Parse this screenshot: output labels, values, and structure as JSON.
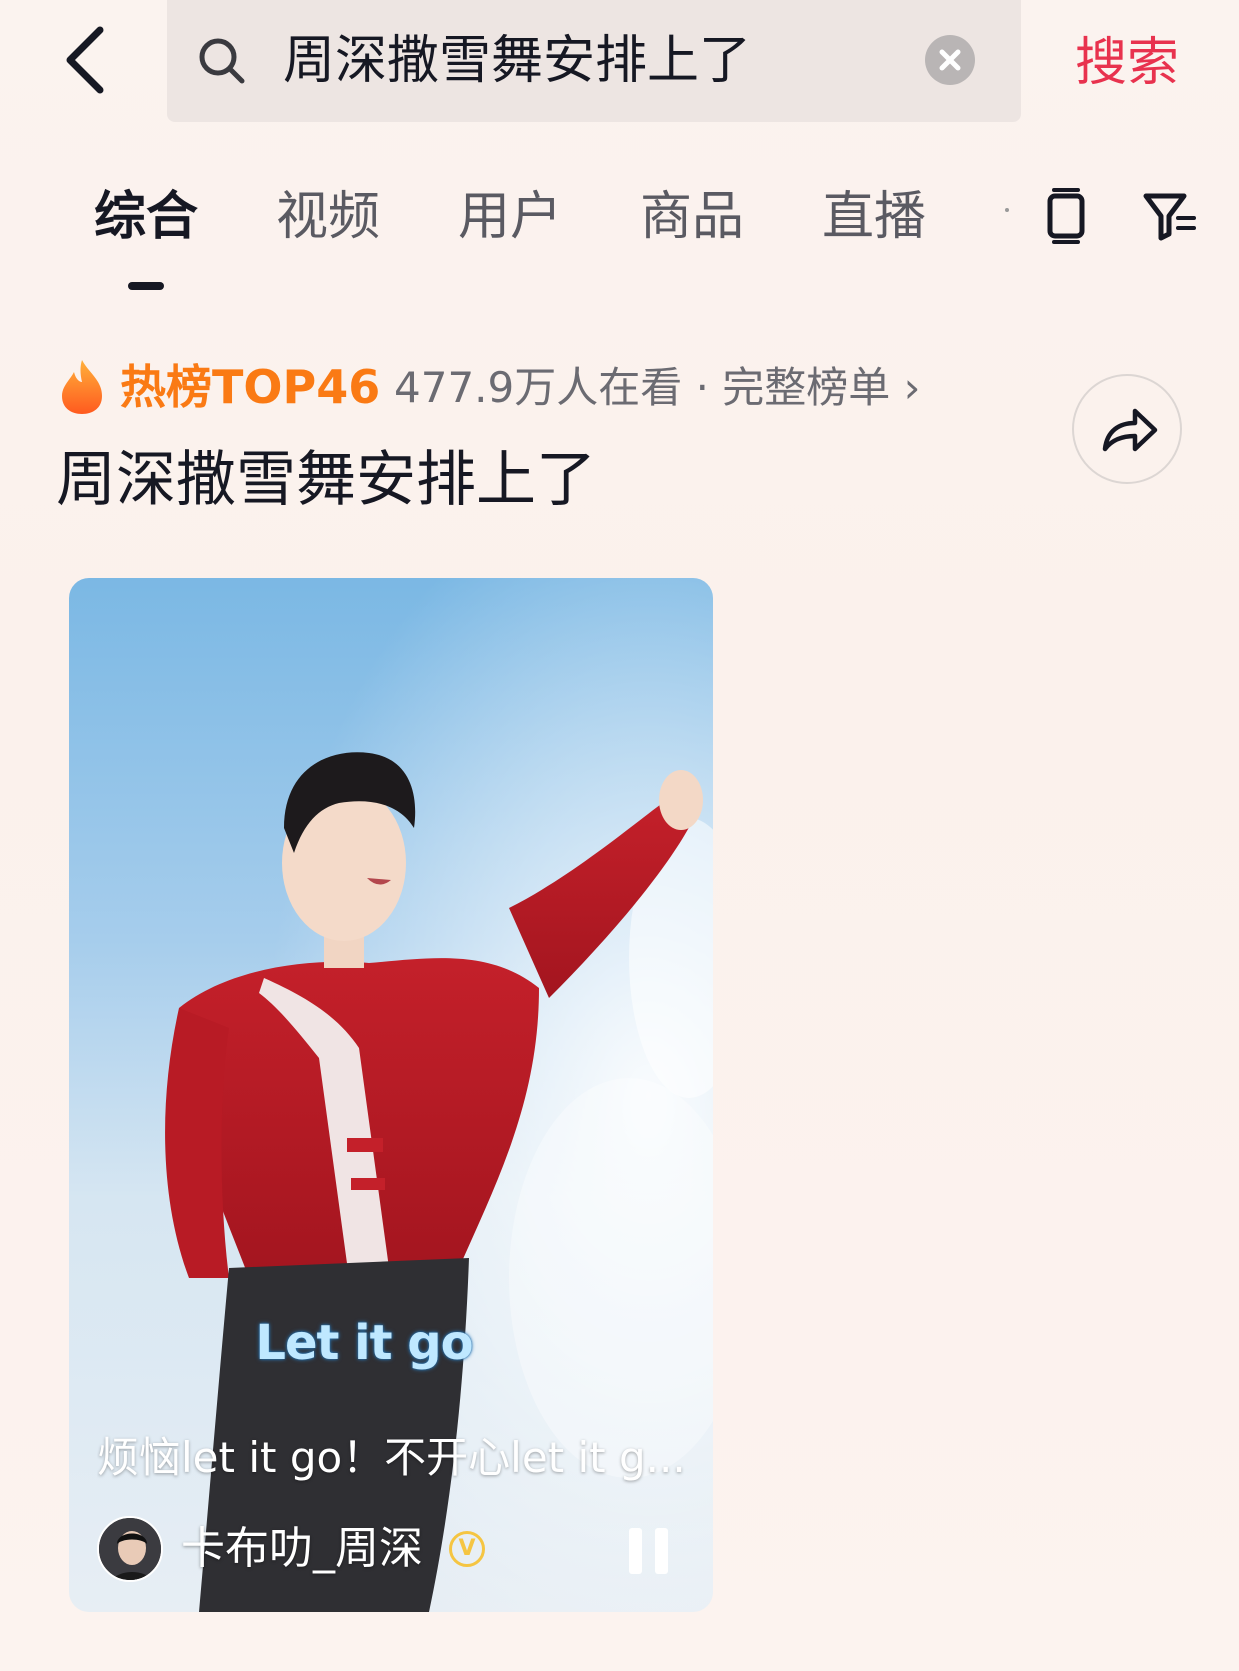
{
  "search": {
    "query": "周深撒雪舞安排上了",
    "submit_label": "搜索"
  },
  "tabs": [
    {
      "label": "综合",
      "active": true
    },
    {
      "label": "视频",
      "active": false
    },
    {
      "label": "用户",
      "active": false
    },
    {
      "label": "商品",
      "active": false
    },
    {
      "label": "直播",
      "active": false
    }
  ],
  "hot": {
    "label": "热榜TOP46",
    "meta": "477.9万人在看 · 完整榜单 ›"
  },
  "topic_title": "周深撒雪舞安排上了",
  "video": {
    "overlay_lyric": "Let it go",
    "caption": "烦恼let it go！不开心let it g...",
    "author": "卡布叻_周深",
    "verified_badge": "V"
  },
  "colors": {
    "accent": "#e8324e",
    "hot": "#fa7a14",
    "text": "#161823",
    "verified": "#f5c542"
  },
  "icons": [
    "back-arrow-icon",
    "search-icon",
    "clear-icon",
    "tablet-icon",
    "filter-icon",
    "flame-icon",
    "share-icon",
    "pause-icon",
    "verified-icon"
  ]
}
